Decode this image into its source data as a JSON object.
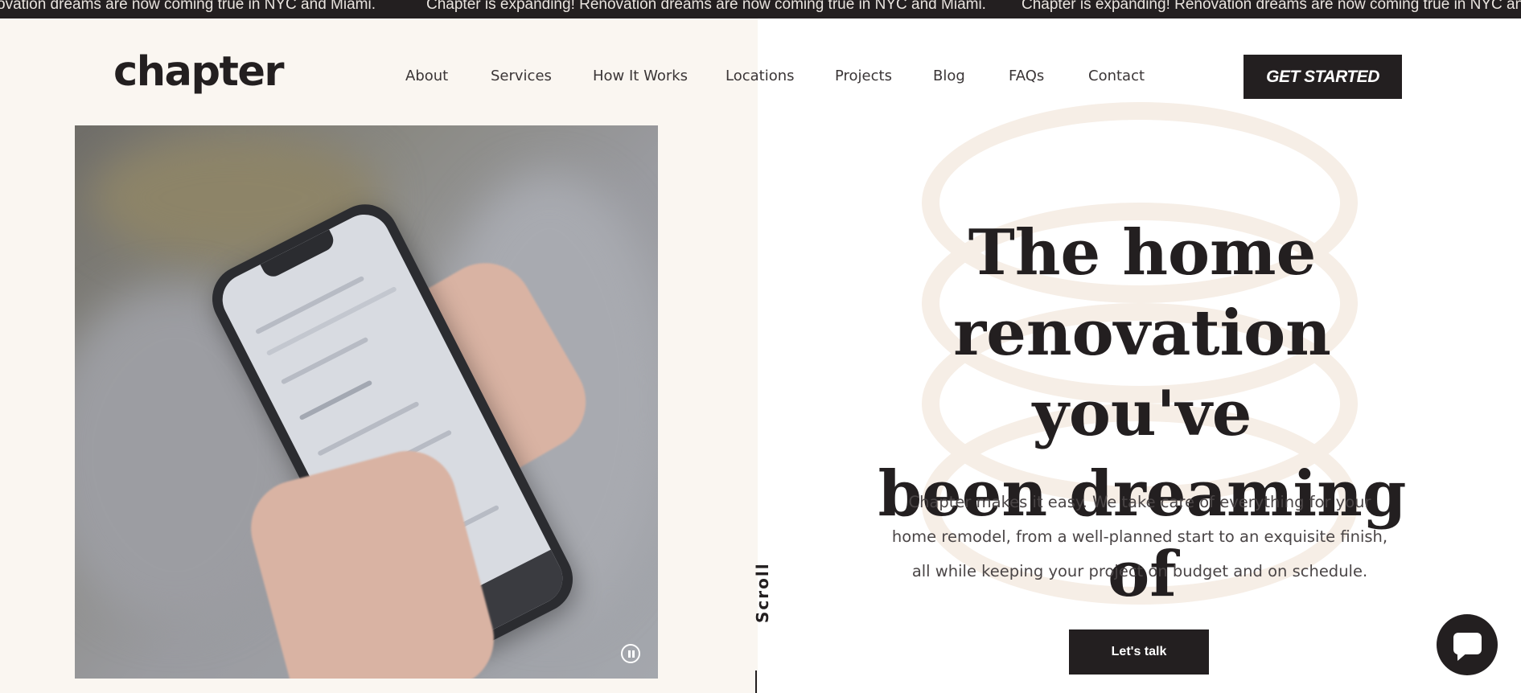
{
  "announcement": {
    "items": [
      "ovation dreams are now coming true in NYC and Miami.",
      "Chapter is expanding! Renovation dreams are now coming true in NYC and Miami.",
      "Chapter is expanding! Renovation dreams are now coming true in NYC and M"
    ]
  },
  "header": {
    "logo": "chapter",
    "nav": [
      "About",
      "Services",
      "How It Works",
      "Locations",
      "Projects",
      "Blog",
      "FAQs",
      "Contact"
    ],
    "cta_label": "GET STARTED"
  },
  "hero": {
    "title_lines": [
      "The home",
      "renovation you've",
      "been dreaming of"
    ],
    "body_lines": [
      "Chapter makes it easy. We take care of everything for your",
      "home remodel, from a well-planned start to an exquisite finish,",
      "all while keeping your project on budget and on schedule."
    ],
    "button_label": "Let's talk",
    "scroll_label": "Scroll"
  },
  "media": {
    "icon": "pause-icon"
  },
  "chat": {
    "icon": "chat-icon"
  },
  "colors": {
    "dark": "#231f20",
    "cream": "#faf6f1",
    "ring": "#f6eee6",
    "white": "#ffffff"
  }
}
